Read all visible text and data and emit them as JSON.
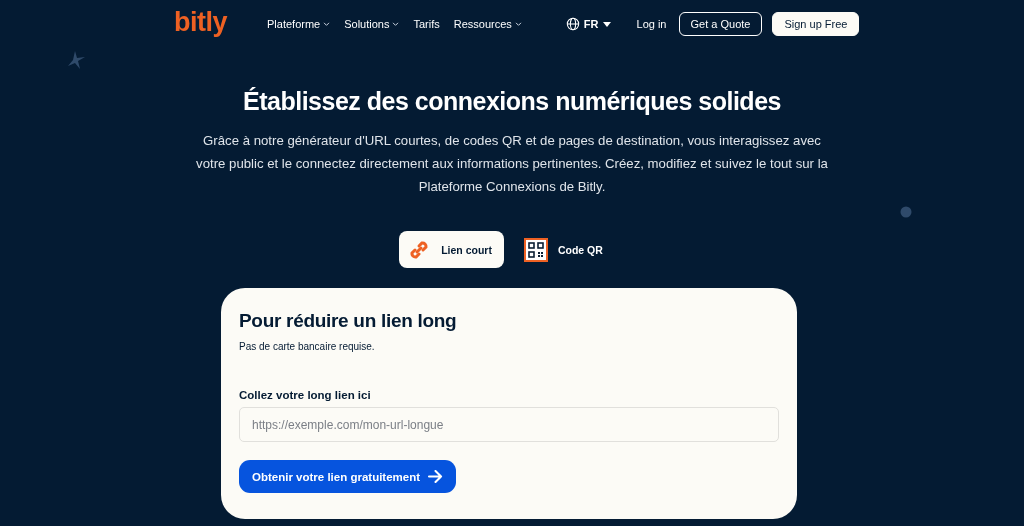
{
  "header": {
    "logo": "bitly",
    "nav": [
      {
        "label": "Plateforme",
        "dropdown": true
      },
      {
        "label": "Solutions",
        "dropdown": true
      },
      {
        "label": "Tarifs",
        "dropdown": false
      },
      {
        "label": "Ressources",
        "dropdown": true
      }
    ],
    "language": "FR",
    "login": "Log in",
    "quote": "Get a Quote",
    "signup": "Sign up Free"
  },
  "hero": {
    "title": "Établissez des connexions numériques solides",
    "text": "Grâce à notre générateur d'URL courtes, de codes QR et de pages de destination, vous interagissez avec votre public et le connectez directement aux informations pertinentes. Créez, modifiez et suivez le tout sur la Plateforme Connexions de Bitly."
  },
  "tabs": [
    {
      "label": "Lien court",
      "kind": "link",
      "selected": true
    },
    {
      "label": "Code QR",
      "kind": "qr",
      "selected": false
    }
  ],
  "card": {
    "title": "Pour réduire un lien long",
    "subtitle": "Pas de carte bancaire requise.",
    "field_label": "Collez votre long lien ici",
    "placeholder": "https://exemple.com/mon-url-longue",
    "button": "Obtenir votre lien gratuitement"
  }
}
